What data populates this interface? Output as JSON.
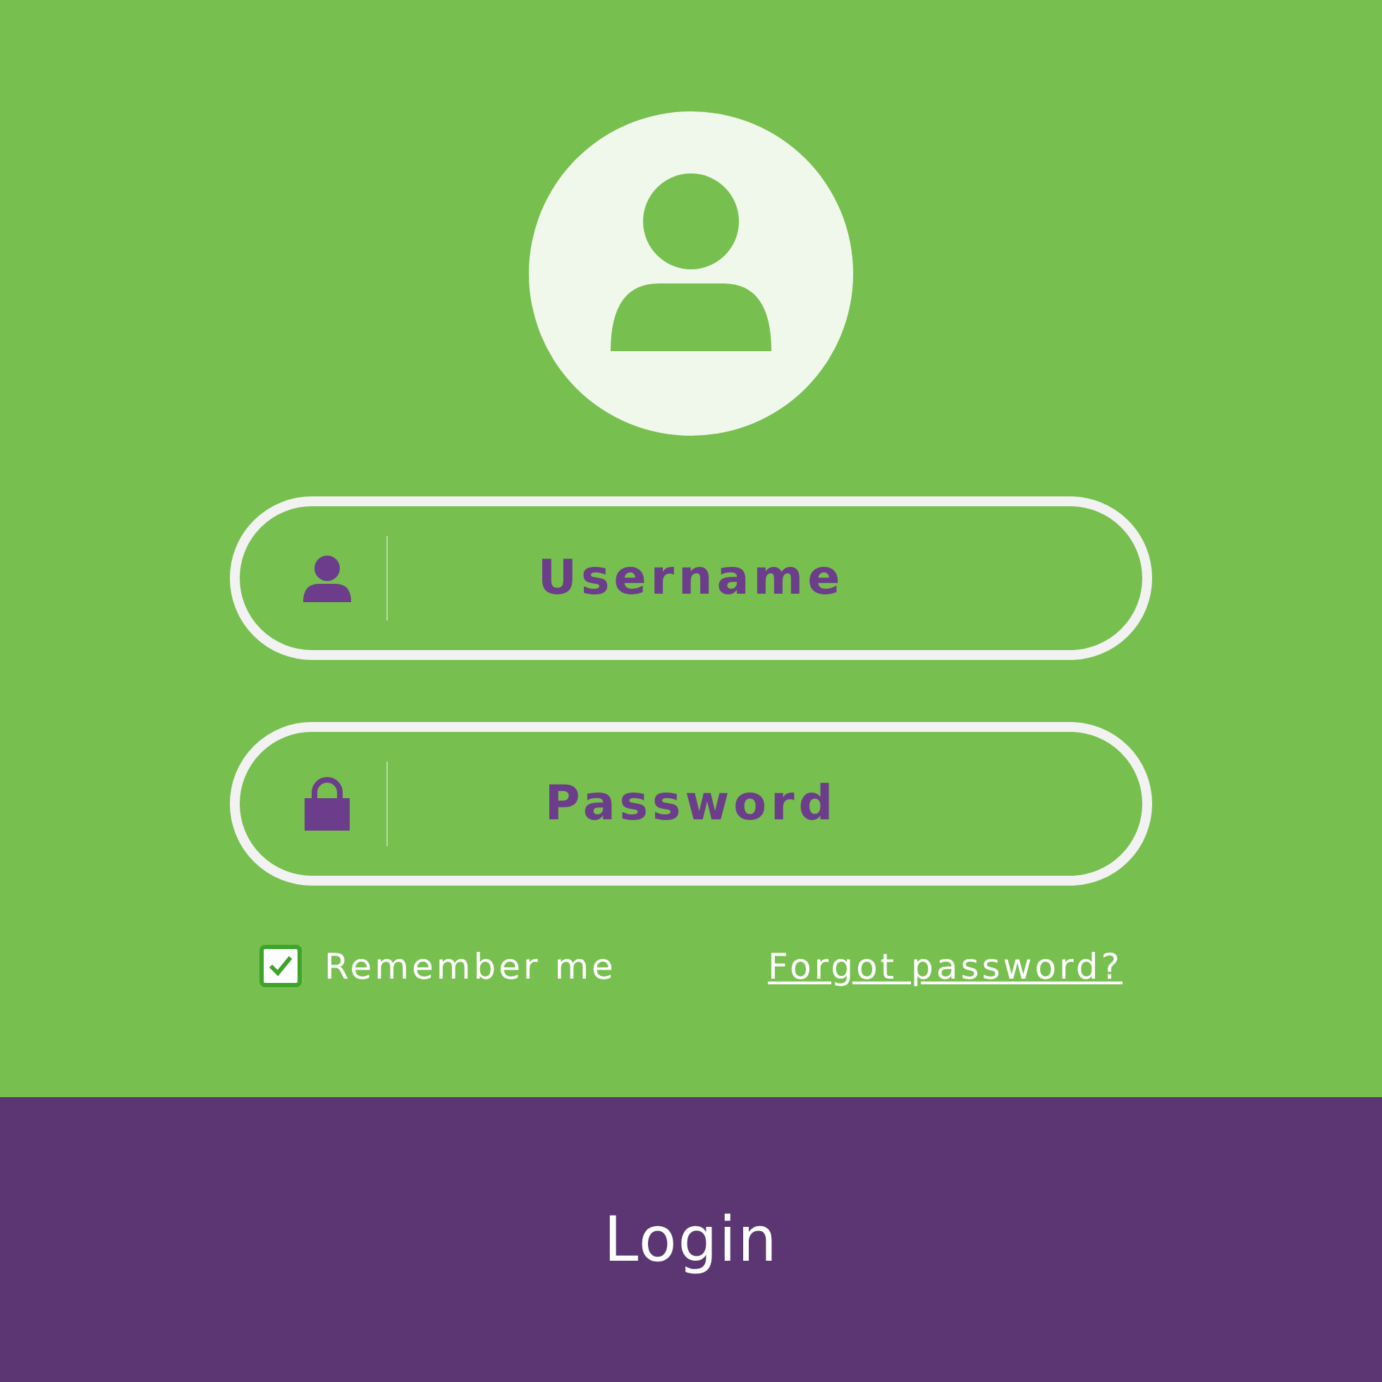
{
  "fields": [
    {
      "kind": "user",
      "placeholder": "Username"
    },
    {
      "kind": "password",
      "placeholder": "Password"
    }
  ],
  "remember": {
    "label": "Remember me",
    "checked": true
  },
  "forgot_link": "Forgot password?",
  "login_button": "Login"
}
